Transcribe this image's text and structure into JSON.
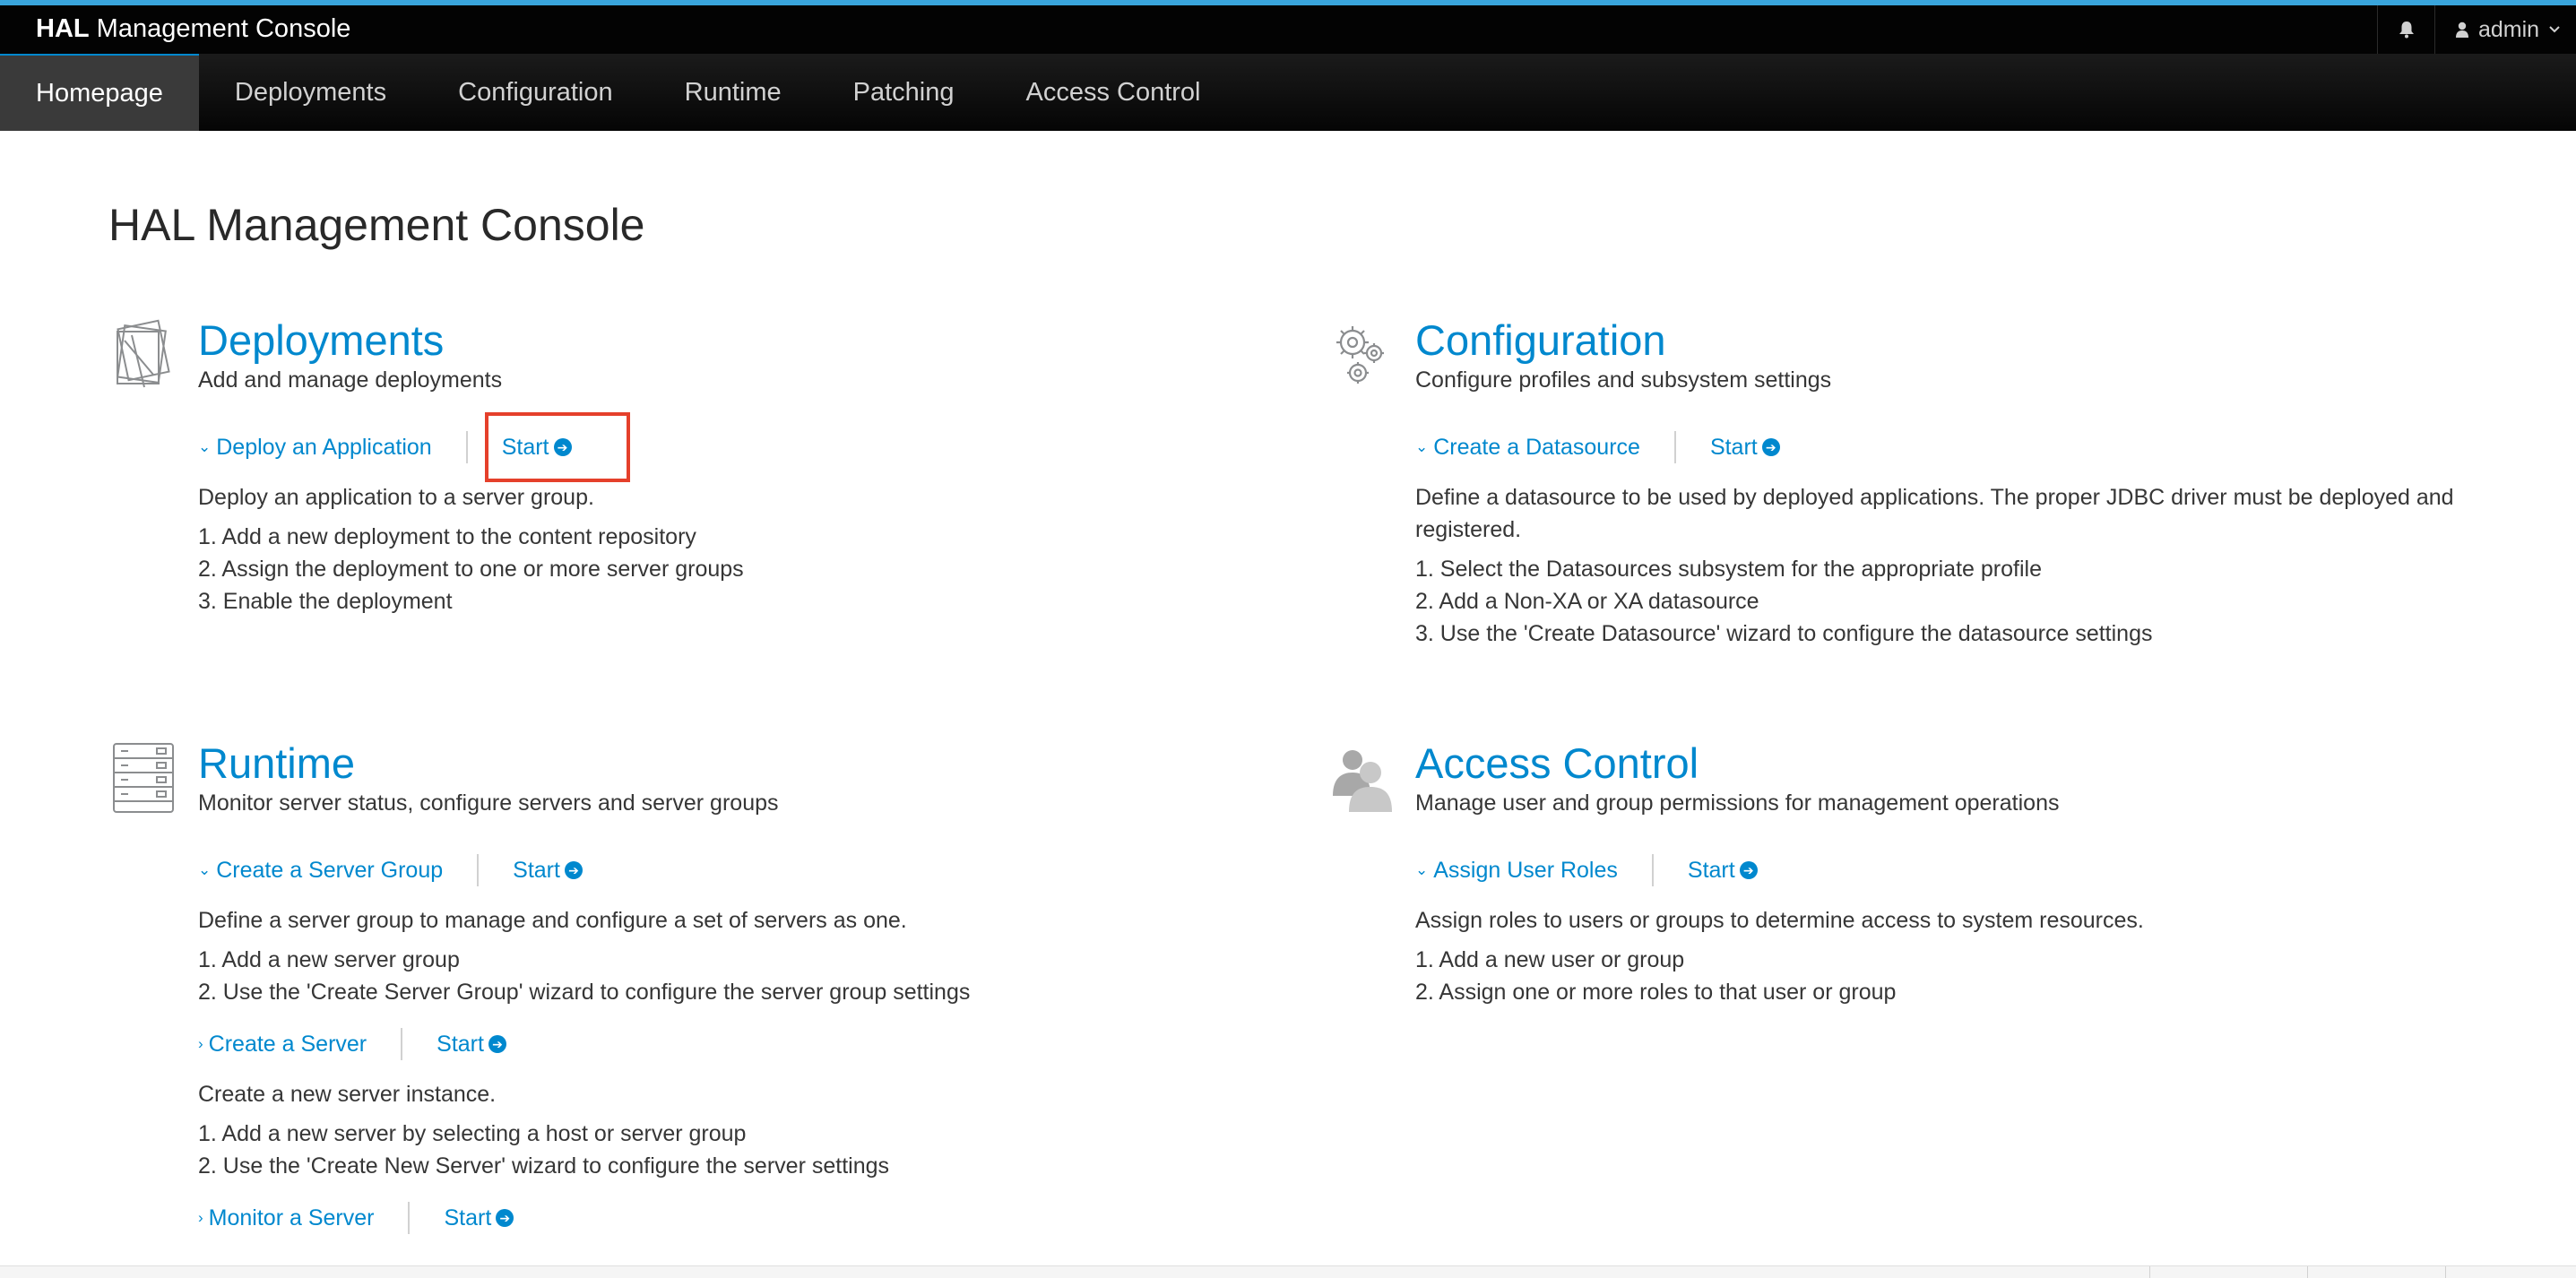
{
  "header": {
    "brand_bold": "HAL",
    "brand_rest": " Management Console",
    "user_label": "admin",
    "accent_color": "#39a5dc"
  },
  "nav": {
    "items": [
      "Homepage",
      "Deployments",
      "Configuration",
      "Runtime",
      "Patching",
      "Access Control"
    ],
    "active": "Homepage"
  },
  "page": {
    "title": "HAL Management Console"
  },
  "sections": {
    "deployments": {
      "icon": "deployments-stack-icon",
      "title": "Deployments",
      "subtitle": "Add and manage deployments",
      "actions": [
        {
          "label": "Deploy an Application",
          "start": "Start",
          "expanded": true,
          "description": "Deploy an application to a server group.",
          "steps": [
            "1. Add a new deployment to the content repository",
            "2. Assign the deployment to one or more server groups",
            "3. Enable the deployment"
          ]
        }
      ]
    },
    "configuration": {
      "icon": "gears-icon",
      "title": "Configuration",
      "subtitle": "Configure profiles and subsystem settings",
      "actions": [
        {
          "label": "Create a Datasource",
          "start": "Start",
          "expanded": true,
          "description": "Define a datasource to be used by deployed applications. The proper JDBC driver must be deployed and registered.",
          "steps": [
            "1. Select the Datasources subsystem for the appropriate profile",
            "2. Add a Non-XA or XA datasource",
            "3. Use the 'Create Datasource' wizard to configure the datasource settings"
          ]
        }
      ]
    },
    "runtime": {
      "icon": "server-rack-icon",
      "title": "Runtime",
      "subtitle": "Monitor server status, configure servers and server groups",
      "actions": [
        {
          "label": "Create a Server Group",
          "start": "Start",
          "expanded": true,
          "description": "Define a server group to manage and configure a set of servers as one.",
          "steps": [
            "1. Add a new server group",
            "2. Use the 'Create Server Group' wizard to configure the server group settings"
          ]
        },
        {
          "label": "Create a Server",
          "start": "Start",
          "expanded": true,
          "description": "Create a new server instance.",
          "steps": [
            "1. Add a new server by selecting a host or server group",
            "2. Use the 'Create New Server' wizard to configure the server settings"
          ]
        },
        {
          "label": "Monitor a Server",
          "start": "Start",
          "expanded": false
        }
      ]
    },
    "access_control": {
      "icon": "users-icon",
      "title": "Access Control",
      "subtitle": "Manage user and group permissions for management operations",
      "actions": [
        {
          "label": "Assign User Roles",
          "start": "Start",
          "expanded": true,
          "description": "Assign roles to users or groups to determine access to system resources.",
          "steps": [
            "1. Add a new user or group",
            "2. Assign one or more roles to that user or group"
          ]
        }
      ]
    }
  },
  "colors": {
    "link": "#0088ce",
    "highlight": "#e5402b",
    "topbar": "#030303",
    "nav_active": "#3a3a3a"
  }
}
